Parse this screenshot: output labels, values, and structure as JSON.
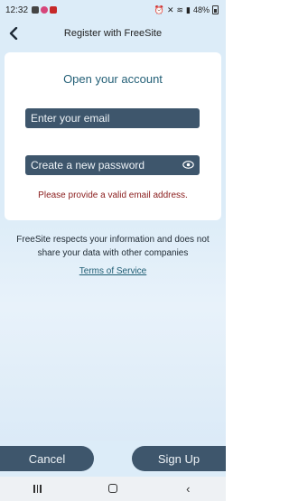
{
  "status_bar": {
    "time": "12:32",
    "battery": "48%",
    "icons_left": [
      "gallery-icon",
      "messenger-icon",
      "youtube-icon"
    ],
    "icons_right": [
      "alarm-icon",
      "mute-icon",
      "wifi-icon",
      "signal-icon",
      "battery-icon"
    ]
  },
  "header": {
    "title": "Register with FreeSite",
    "back_icon": "back-chevron-icon"
  },
  "form": {
    "heading": "Open your account",
    "email_placeholder": "Enter your email",
    "password_placeholder": "Create a new password",
    "password_toggle_icon": "eye-icon",
    "error": "Please provide a valid email address."
  },
  "privacy": {
    "text": "FreeSite respects your information and does not share your data with other companies",
    "terms_link": "Terms of Service"
  },
  "actions": {
    "cancel_label": "Cancel",
    "signup_label": "Sign Up"
  },
  "nav": {
    "back_glyph": "‹"
  },
  "colors": {
    "header_bg": "#dcecf8",
    "field_bg": "#3e566c",
    "heading": "#246077",
    "error": "#8a1c1c"
  }
}
